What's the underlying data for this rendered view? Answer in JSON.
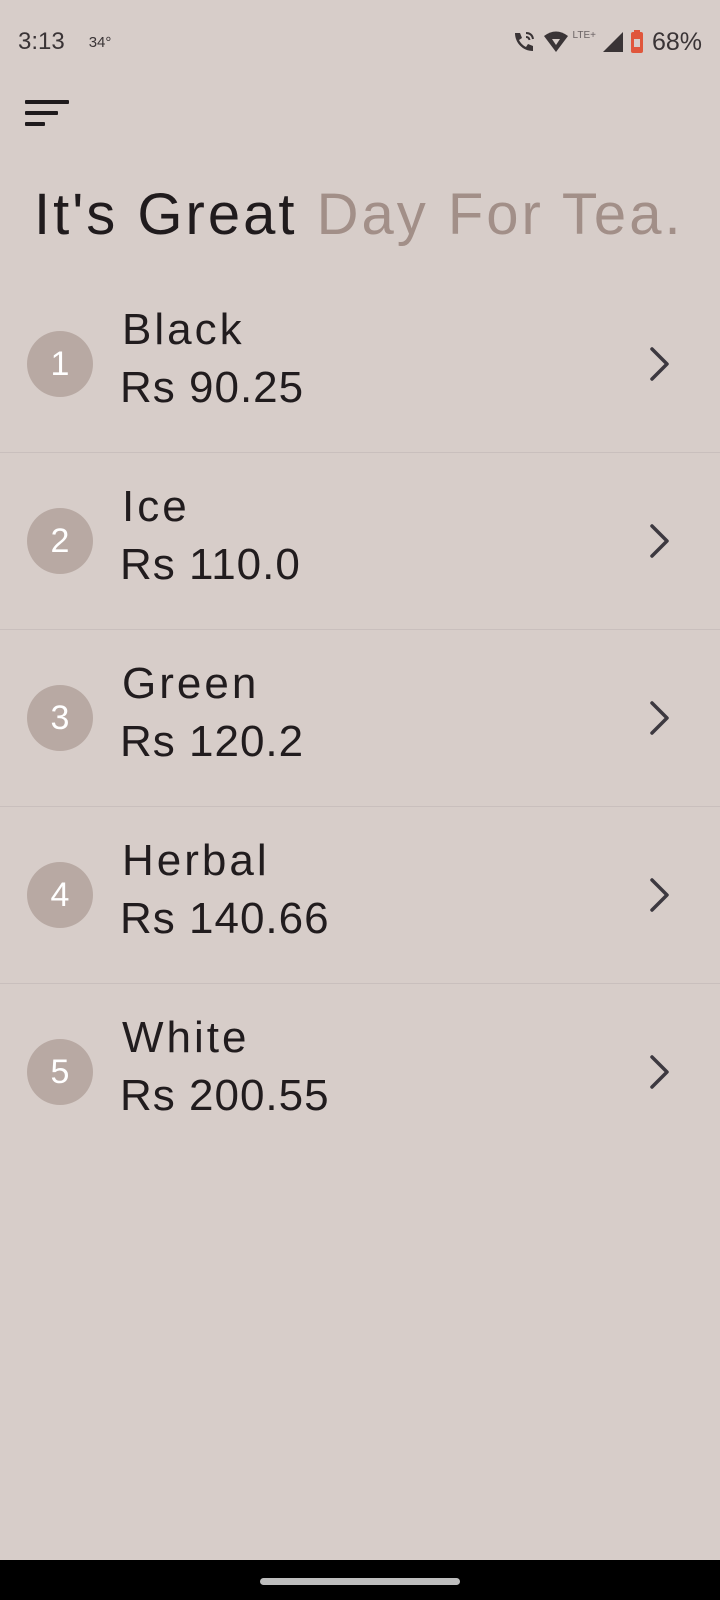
{
  "status_bar": {
    "time": "3:13",
    "temperature": "34°",
    "network_label": "LTE+",
    "battery": "68%",
    "icons": [
      "wifi-calling-icon",
      "wifi-icon",
      "cell-signal-icon",
      "battery-saver-icon"
    ]
  },
  "header": {
    "menu_icon": "sort-menu-icon",
    "title_part1": "It's Great",
    "title_part2": "Day For Tea."
  },
  "teas": [
    {
      "number": "1",
      "name": "Black",
      "price": "Rs 90.25"
    },
    {
      "number": "2",
      "name": "Ice",
      "price": "Rs 110.0"
    },
    {
      "number": "3",
      "name": "Green",
      "price": "Rs 120.2"
    },
    {
      "number": "4",
      "name": "Herbal",
      "price": "Rs 140.66"
    },
    {
      "number": "5",
      "name": "White",
      "price": "Rs 200.55"
    }
  ],
  "colors": {
    "background": "#d7cdc9",
    "accent_text": "#a28f88",
    "badge": "#b8a9a3",
    "battery_saver": "#e0563b"
  }
}
